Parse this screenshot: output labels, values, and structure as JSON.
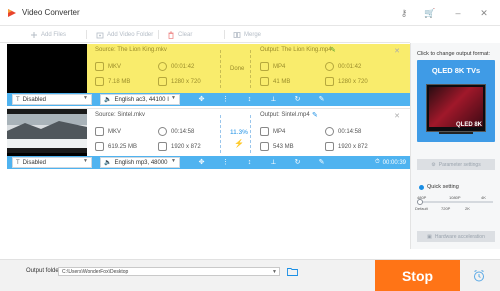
{
  "window": {
    "title": "Video Converter",
    "brand_color": "#e8432c"
  },
  "toolbar": {
    "add_files": "Add Files",
    "add_video_folder": "Add Video Folder",
    "clear": "Clear",
    "merge": "Merge"
  },
  "tasks": [
    {
      "source_label": "Source: The Lion King.mkv",
      "source_format": "MKV",
      "source_duration": "00:01:42",
      "source_size": "7.18 MB",
      "source_resolution": "1280 x 720",
      "status": "Done",
      "output_label": "Output: The Lion King.mp4",
      "output_format": "MP4",
      "output_duration": "00:01:42",
      "output_size": "41 MB",
      "output_resolution": "1280 x 720",
      "subtitle": "Disabled",
      "audio": "English ac3, 44100 I",
      "highlight_color": "#f9ec6c"
    },
    {
      "source_label": "Source: Sintel.mkv",
      "source_format": "MKV",
      "source_duration": "00:14:58",
      "source_size": "619.25 MB",
      "source_resolution": "1920 x 872",
      "status": "11.3%",
      "output_label": "Output: Sintel.mp4",
      "output_format": "MP4",
      "output_duration": "00:14:58",
      "output_size": "543 MB",
      "output_resolution": "1920 x 872",
      "subtitle": "Disabled",
      "audio": "English mp3, 48000",
      "timer": "00:00:39"
    }
  ],
  "right_panel": {
    "title": "Click to change output format:",
    "format_name": "QLED 8K TVs",
    "tv_label": "QLED 8K",
    "parameter_settings": "Parameter settings",
    "quick_setting": "Quick setting",
    "quality_top": [
      "480P",
      "1080P",
      "4K"
    ],
    "quality_bottom": [
      "Default",
      "720P",
      "2K"
    ],
    "quality_level": 0,
    "hardware_acceleration": "Hardware acceleration",
    "accent_color": "#3f9be6"
  },
  "bottom": {
    "output_folder_label": "Output folder:",
    "output_folder_path": "C:\\Users\\WonderFox\\Desktop",
    "stop_label": "Stop",
    "stop_color": "#ff7416"
  }
}
